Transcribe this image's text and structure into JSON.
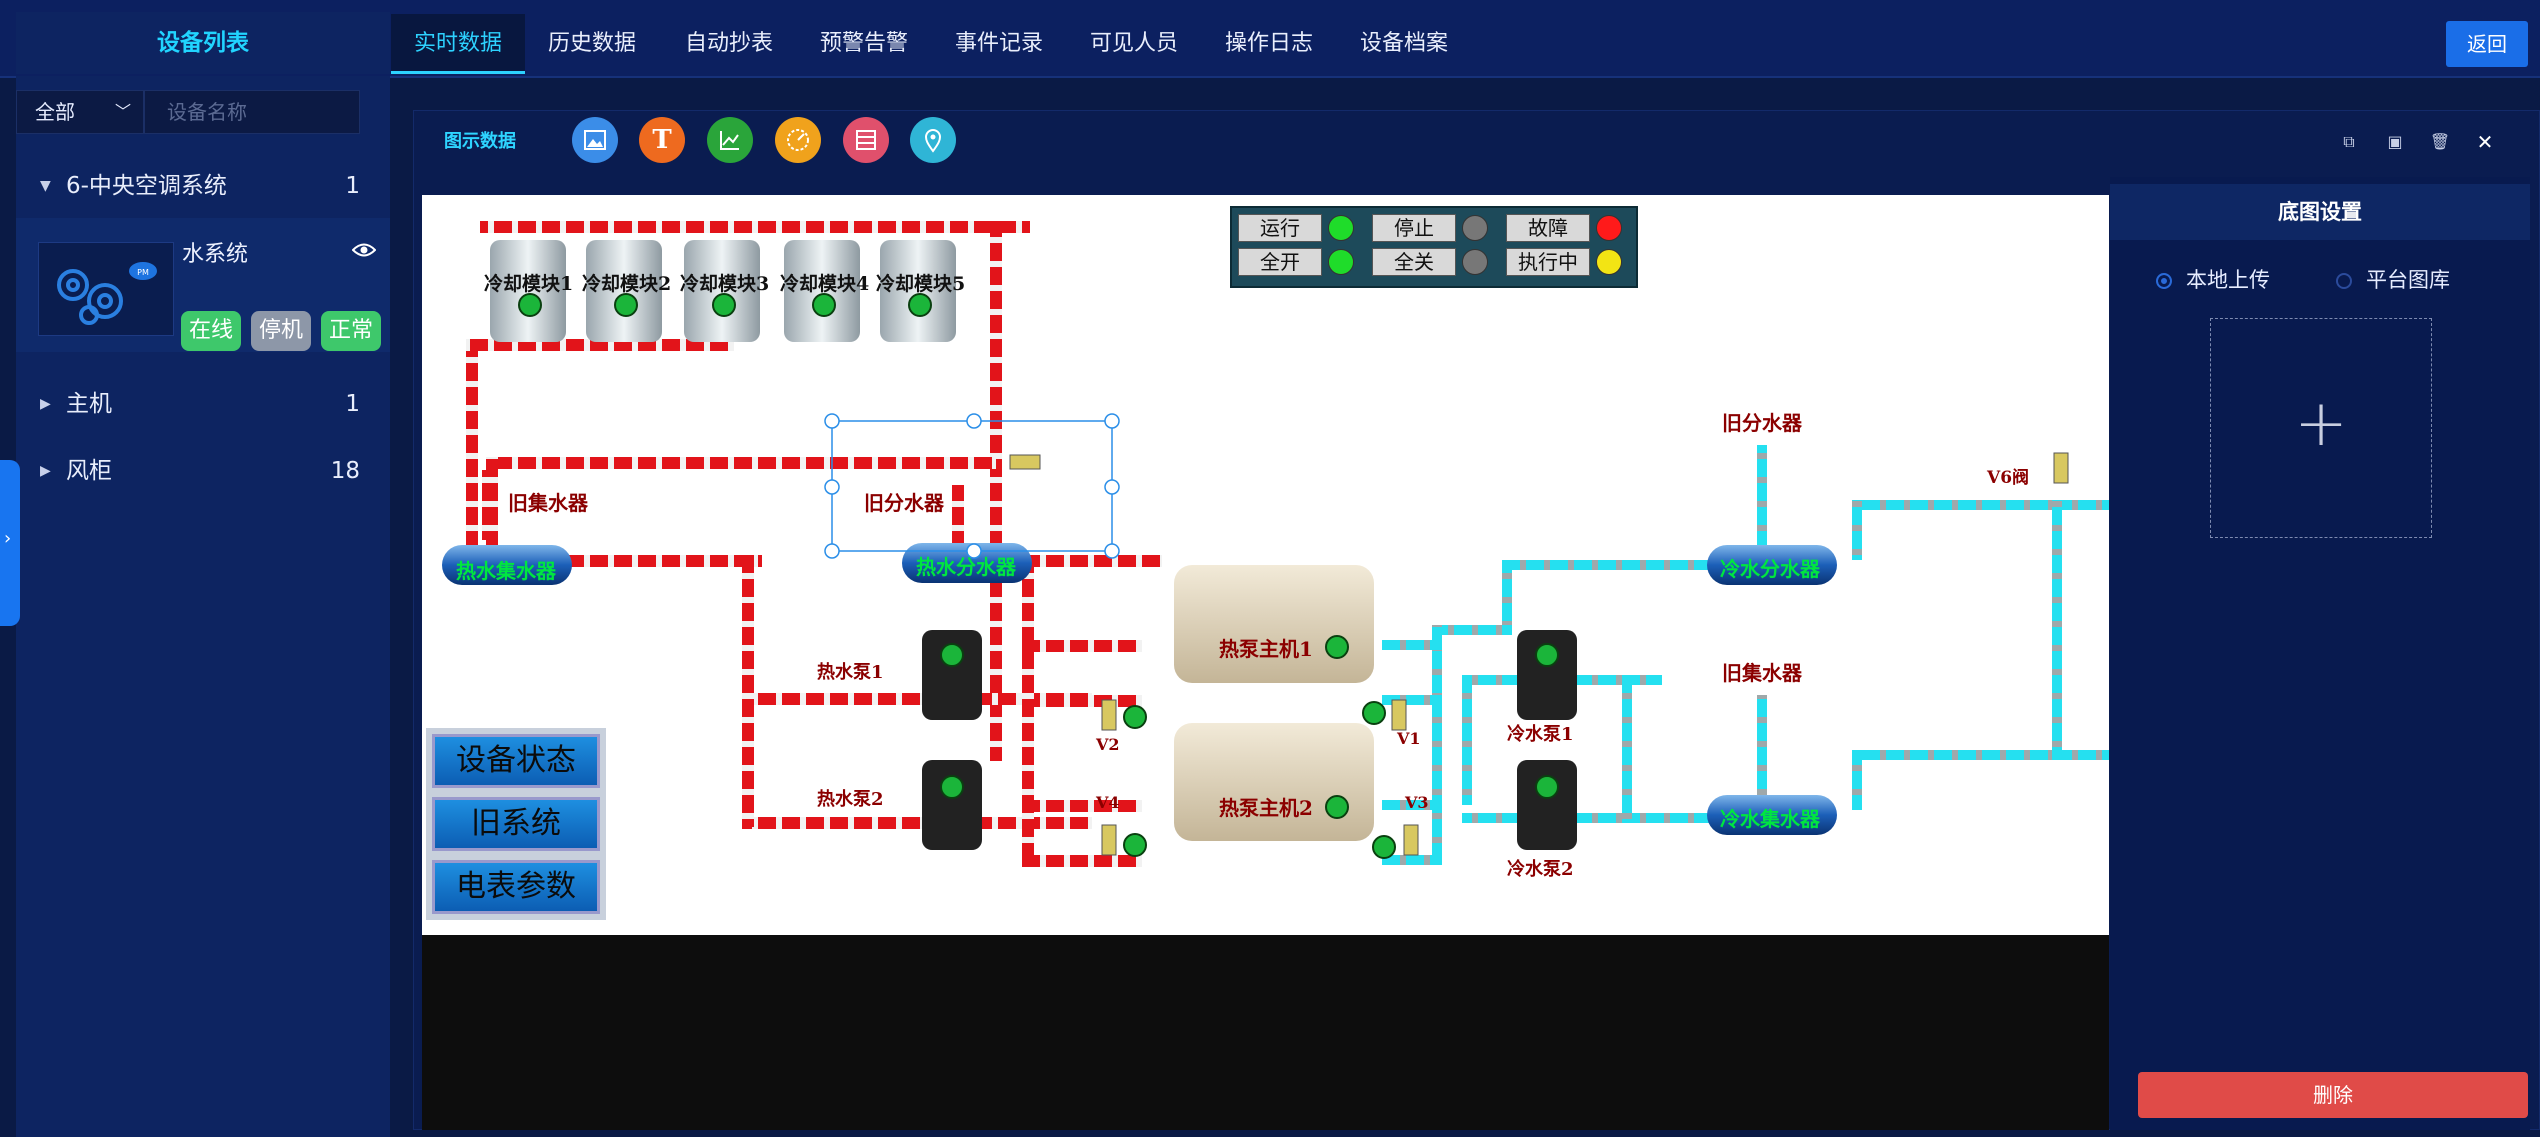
{
  "sidebar": {
    "title": "设备列表",
    "filter_value": "全部",
    "search_placeholder": "设备名称",
    "groups": [
      {
        "label": "6-中央空调系统",
        "count": "1"
      },
      {
        "label": "主机",
        "count": "1"
      },
      {
        "label": "风柜",
        "count": "18"
      }
    ],
    "device": {
      "name": "水系统",
      "badges": [
        {
          "label": "在线",
          "color": "#3ec86b"
        },
        {
          "label": "停机",
          "color": "#8d97a8"
        },
        {
          "label": "正常",
          "color": "#3ec86b"
        }
      ]
    }
  },
  "nav": {
    "tabs": [
      "实时数据",
      "历史数据",
      "自动抄表",
      "预警告警",
      "事件记录",
      "可见人员",
      "操作日志",
      "设备档案"
    ],
    "active": "实时数据",
    "back_label": "返回"
  },
  "toolbar": {
    "label": "图示数据",
    "icons": [
      {
        "name": "image-icon",
        "color": "#3b8de8",
        "glyph": "▣"
      },
      {
        "name": "text-icon",
        "color": "#ee6a1f",
        "glyph": "T"
      },
      {
        "name": "line-chart-icon",
        "color": "#2aa53a",
        "glyph": "↗"
      },
      {
        "name": "gauge-icon",
        "color": "#f0a21c",
        "glyph": "◔"
      },
      {
        "name": "table-icon",
        "color": "#e0506c",
        "glyph": "☰"
      },
      {
        "name": "location-icon",
        "color": "#2fb5d6",
        "glyph": "⌖"
      }
    ]
  },
  "diagram": {
    "cooling_modules": [
      "冷却模块1",
      "冷却模块2",
      "冷却模块3",
      "冷却模块4",
      "冷却模块5"
    ],
    "labels": {
      "old_collector_left": "旧集水器",
      "old_divider_mid": "旧分水器",
      "hot_collector": "热水集水器",
      "hot_divider": "热水分水器",
      "hot_pump1": "热水泵1",
      "hot_pump2": "热水泵2",
      "heat_pump1": "热泵主机1",
      "heat_pump2": "热泵主机2",
      "cold_pump1": "冷水泵1",
      "cold_pump2": "冷水泵2",
      "old_divider_right": "旧分水器",
      "old_collector_right": "旧集水器",
      "cold_divider": "冷水分水器",
      "cold_collector": "冷水集水器",
      "v1": "V1",
      "v2": "V2",
      "v3": "V3",
      "v4": "V4",
      "v6": "V6阀"
    },
    "status_panel": [
      {
        "label": "运行",
        "led": "#1fdc2a"
      },
      {
        "label": "停止",
        "led": "#777777"
      },
      {
        "label": "故障",
        "led": "#ff1a1a"
      },
      {
        "label": "全开",
        "led": "#1fdc2a"
      },
      {
        "label": "全关",
        "led": "#777777"
      },
      {
        "label": "执行中",
        "led": "#f2e414"
      }
    ],
    "side_buttons": [
      "设备状态",
      "旧系统",
      "电表参数"
    ]
  },
  "settings": {
    "title": "底图设置",
    "radio_options": [
      "本地上传",
      "平台图库"
    ],
    "selected": "本地上传",
    "upload_glyph": "+",
    "delete_label": "删除"
  },
  "window_buttons": [
    "restore-icon",
    "save-icon",
    "trash-icon",
    "close-icon"
  ]
}
